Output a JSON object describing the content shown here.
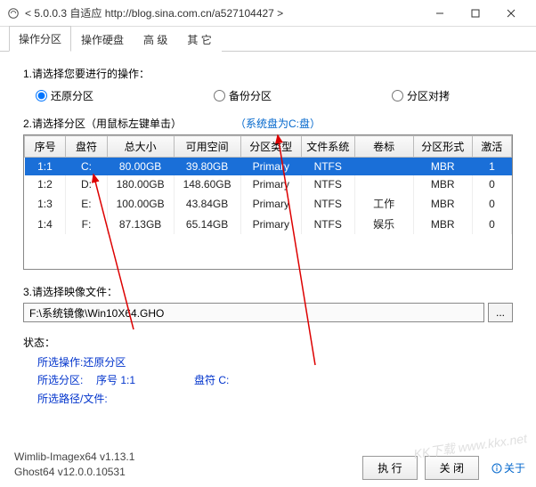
{
  "titlebar": {
    "text": "< 5.0.0.3 自适应 http://blog.sina.com.cn/a527104427 >"
  },
  "tabs": {
    "items": [
      {
        "label": "操作分区"
      },
      {
        "label": "操作硬盘"
      },
      {
        "label": "高  级"
      },
      {
        "label": "其  它"
      }
    ],
    "active_index": 0
  },
  "section1": {
    "label": "1.请选择您要进行的操作：",
    "options": [
      {
        "label": "还原分区",
        "checked": true
      },
      {
        "label": "备份分区",
        "checked": false
      },
      {
        "label": "分区对拷",
        "checked": false
      }
    ]
  },
  "section2": {
    "label": "2.请选择分区（用鼠标左键单击）",
    "note": "（系统盘为C:盘）",
    "headers": [
      "序号",
      "盘符",
      "总大小",
      "可用空间",
      "分区类型",
      "文件系统",
      "卷标",
      "分区形式",
      "激活"
    ],
    "rows": [
      {
        "seq": "1:1",
        "drv": "C:",
        "total": "80.00GB",
        "free": "39.80GB",
        "ptype": "Primary",
        "fs": "NTFS",
        "vol": "",
        "pform": "MBR",
        "act": "1",
        "selected": true
      },
      {
        "seq": "1:2",
        "drv": "D:",
        "total": "180.00GB",
        "free": "148.60GB",
        "ptype": "Primary",
        "fs": "NTFS",
        "vol": "",
        "pform": "MBR",
        "act": "0",
        "selected": false
      },
      {
        "seq": "1:3",
        "drv": "E:",
        "total": "100.00GB",
        "free": "43.84GB",
        "ptype": "Primary",
        "fs": "NTFS",
        "vol": "工作",
        "pform": "MBR",
        "act": "0",
        "selected": false
      },
      {
        "seq": "1:4",
        "drv": "F:",
        "total": "87.13GB",
        "free": "65.14GB",
        "ptype": "Primary",
        "fs": "NTFS",
        "vol": "娱乐",
        "pform": "MBR",
        "act": "0",
        "selected": false
      }
    ]
  },
  "section3": {
    "label": "3.请选择映像文件：",
    "value": "F:\\系统镜像\\Win10X64.GHO",
    "browse_label": "..."
  },
  "status": {
    "label": "状态：",
    "op_label": "所选操作: ",
    "op_value": "还原分区",
    "part_label": "所选分区:",
    "part_seq_label": "序号 1:1",
    "part_drv_label": "盘符 C:",
    "path_label": "所选路径/文件:"
  },
  "footer": {
    "version_line1": "Wimlib-Imagex64 v1.13.1",
    "version_line2": "Ghost64 v12.0.0.10531",
    "exec_label": "执  行",
    "close_label": "关  闭",
    "about_label": "关于"
  },
  "watermark": "KK下载\nwww.kkx.net"
}
